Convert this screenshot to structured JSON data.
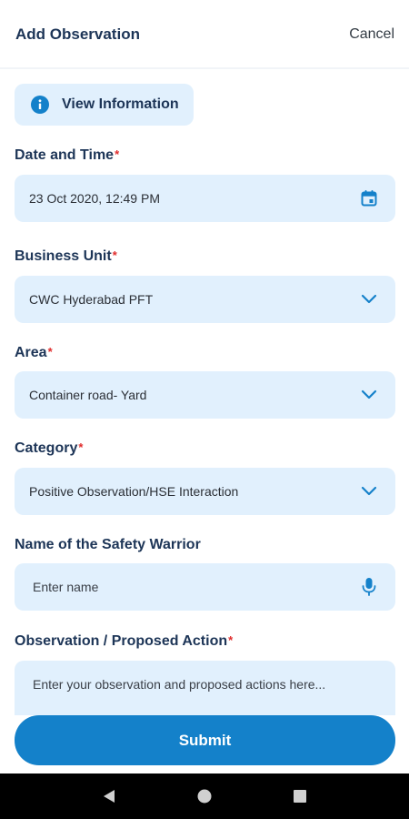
{
  "header": {
    "title": "Add Observation",
    "cancel_label": "Cancel"
  },
  "info_button": {
    "label": "View Information",
    "icon": "info-icon"
  },
  "fields": {
    "date_time": {
      "label": "Date and Time",
      "required_mark": "*",
      "value": "23 Oct 2020, 12:49 PM",
      "icon": "calendar-icon"
    },
    "business_unit": {
      "label": "Business Unit",
      "required_mark": "*",
      "value": "CWC Hyderabad PFT",
      "icon": "chevron-down-icon"
    },
    "area": {
      "label": "Area",
      "required_mark": "*",
      "value": "Container road- Yard",
      "icon": "chevron-down-icon"
    },
    "category": {
      "label": "Category",
      "required_mark": "*",
      "value": "Positive Observation/HSE Interaction",
      "icon": "chevron-down-icon"
    },
    "safety_warrior": {
      "label": "Name of the Safety Warrior",
      "placeholder": "Enter name",
      "icon": "microphone-icon"
    },
    "observation": {
      "label": "Observation / Proposed Action",
      "required_mark": "*",
      "placeholder": "Enter your observation and proposed actions here..."
    }
  },
  "submit_label": "Submit",
  "colors": {
    "accent": "#1481ca",
    "field_bg": "#e1f0fd",
    "label_text": "#1d3557",
    "required": "#e02b2b",
    "nav_bg": "#000000"
  },
  "navbar": {
    "icons": [
      "back-triangle-icon",
      "home-circle-icon",
      "recents-square-icon"
    ]
  }
}
